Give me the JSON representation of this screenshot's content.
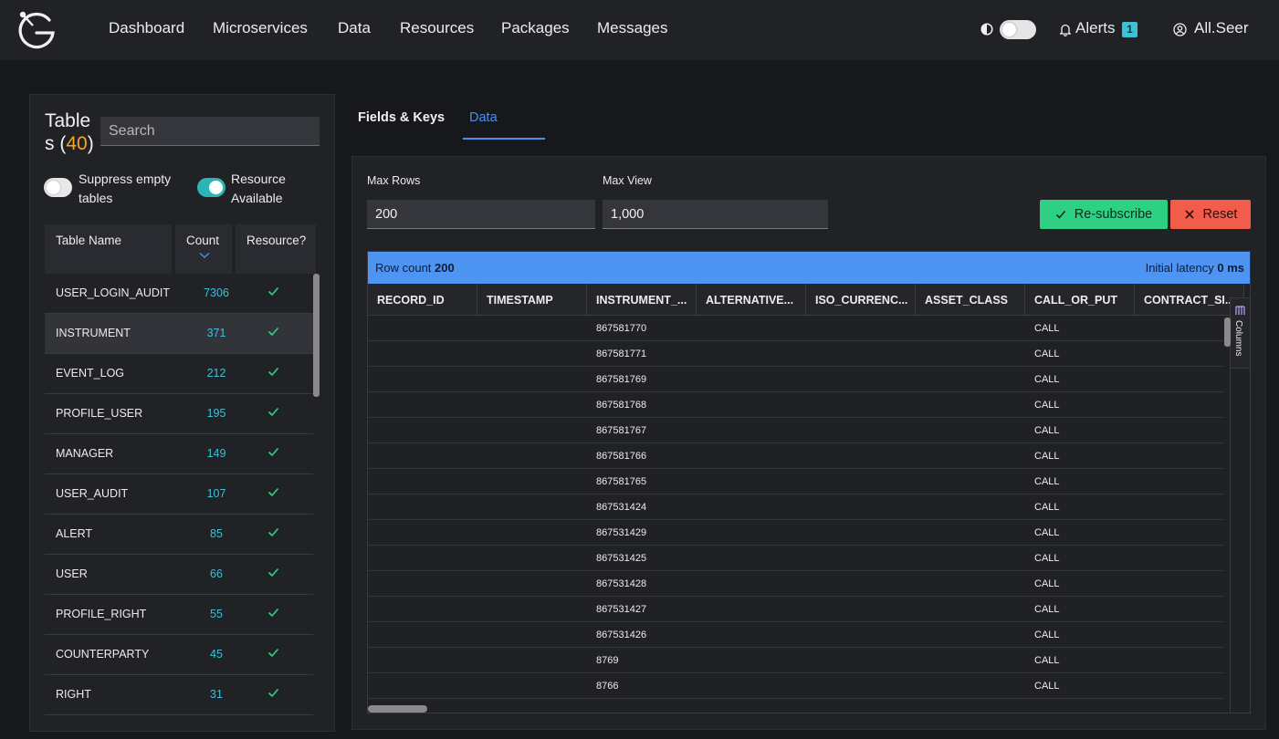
{
  "nav": {
    "links": [
      "Dashboard",
      "Microservices",
      "Data",
      "Resources",
      "Packages",
      "Messages"
    ],
    "alerts_label": "Alerts",
    "alerts_count": "1",
    "user_name": "All.Seer"
  },
  "sidebar": {
    "title_part1": "Table",
    "title_part2": "s (",
    "title_count": "40",
    "title_close": ")",
    "search_placeholder": "Search",
    "toggle_suppress_label": "Suppress empty tables",
    "toggle_resource_label": "Resource Available",
    "columns": [
      "Table Name",
      "Count",
      "Resource?"
    ],
    "rows": [
      {
        "name": "USER_LOGIN_AUDIT",
        "count": "7306"
      },
      {
        "name": "INSTRUMENT",
        "count": "371"
      },
      {
        "name": "EVENT_LOG",
        "count": "212"
      },
      {
        "name": "PROFILE_USER",
        "count": "195"
      },
      {
        "name": "MANAGER",
        "count": "149"
      },
      {
        "name": "USER_AUDIT",
        "count": "107"
      },
      {
        "name": "ALERT",
        "count": "85"
      },
      {
        "name": "USER",
        "count": "66"
      },
      {
        "name": "PROFILE_RIGHT",
        "count": "55"
      },
      {
        "name": "COUNTERPARTY",
        "count": "45"
      },
      {
        "name": "RIGHT",
        "count": "31"
      }
    ]
  },
  "tabs": {
    "fields": "Fields & Keys",
    "data": "Data"
  },
  "controls": {
    "max_rows_label": "Max Rows",
    "max_rows_value": "200",
    "max_view_label": "Max View",
    "max_view_value": "1,000",
    "resubscribe_label": "Re-subscribe",
    "reset_label": "Reset"
  },
  "grid": {
    "row_count_label": "Row count",
    "row_count_value": "200",
    "latency_label": "Initial latency",
    "latency_value": "0 ms",
    "columns": [
      "RECORD_ID",
      "TIMESTAMP",
      "INSTRUMENT_...",
      "ALTERNATIVE...",
      "ISO_CURRENC...",
      "ASSET_CLASS",
      "CALL_OR_PUT",
      "CONTRACT_SI..."
    ],
    "columns_tab_label": "Columns",
    "rows": [
      {
        "instrument": "867581770",
        "call_or_put": "CALL"
      },
      {
        "instrument": "867581771",
        "call_or_put": "CALL"
      },
      {
        "instrument": "867581769",
        "call_or_put": "CALL"
      },
      {
        "instrument": "867581768",
        "call_or_put": "CALL"
      },
      {
        "instrument": "867581767",
        "call_or_put": "CALL"
      },
      {
        "instrument": "867581766",
        "call_or_put": "CALL"
      },
      {
        "instrument": "867581765",
        "call_or_put": "CALL"
      },
      {
        "instrument": "867531424",
        "call_or_put": "CALL"
      },
      {
        "instrument": "867531429",
        "call_or_put": "CALL"
      },
      {
        "instrument": "867531425",
        "call_or_put": "CALL"
      },
      {
        "instrument": "867531428",
        "call_or_put": "CALL"
      },
      {
        "instrument": "867531427",
        "call_or_put": "CALL"
      },
      {
        "instrument": "867531426",
        "call_or_put": "CALL"
      },
      {
        "instrument": "8769",
        "call_or_put": "CALL"
      },
      {
        "instrument": "8766",
        "call_or_put": "CALL"
      }
    ]
  },
  "icons": {
    "logo": "genesis-logo-icon",
    "contrast": "contrast-icon",
    "bell": "bell-icon",
    "user": "user-circle-icon",
    "check": "check-icon",
    "close": "close-icon",
    "sort": "chevron-down-icon",
    "columns": "columns-icon"
  },
  "colors": {
    "accent_blue": "#4d8ef0",
    "teal": "#3ec0d6",
    "orange": "#f5a623",
    "green": "#2ed184",
    "red": "#f25c4a"
  }
}
